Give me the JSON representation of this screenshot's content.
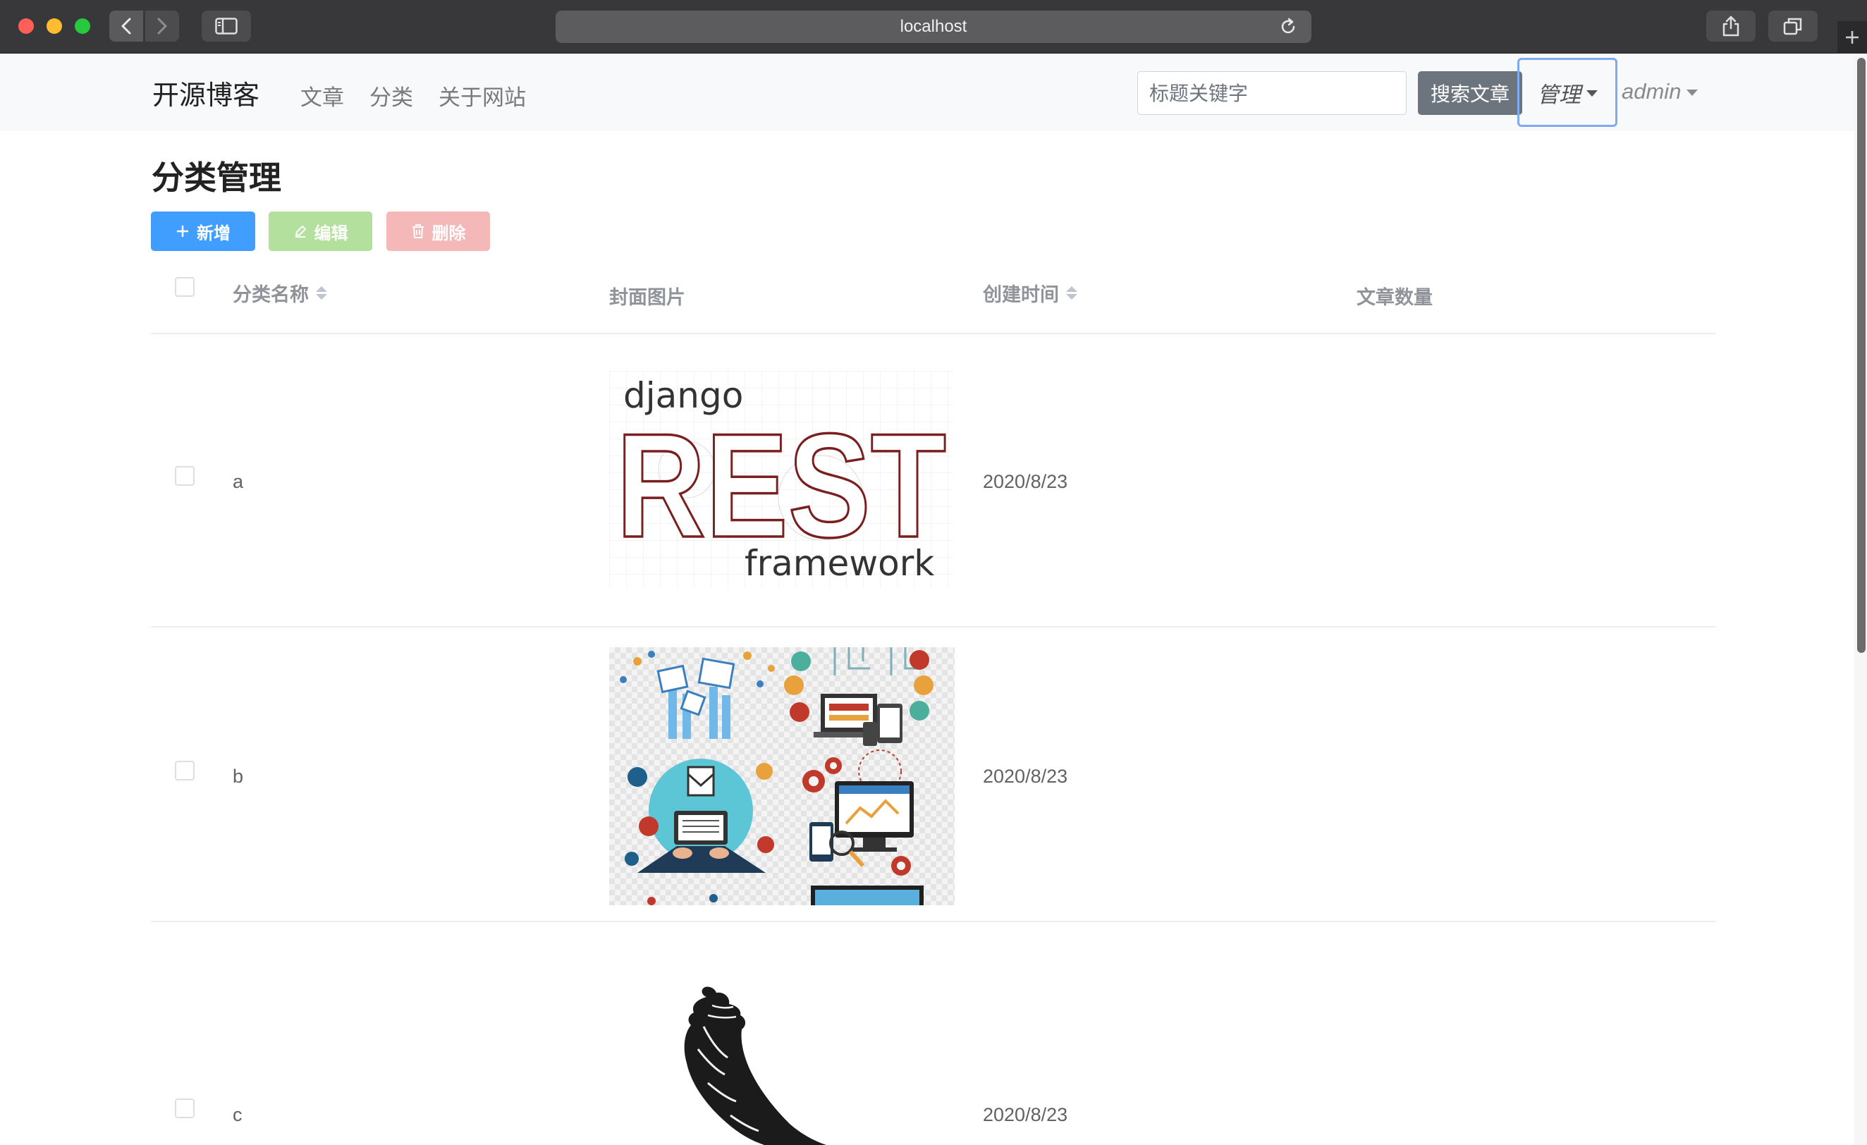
{
  "browser": {
    "url": "localhost"
  },
  "navbar": {
    "brand": "开源博客",
    "links": [
      "文章",
      "分类",
      "关于网站"
    ],
    "search_placeholder": "标题关键字",
    "search_button": "搜索文章",
    "manage_label": "管理",
    "user_label": "admin"
  },
  "page": {
    "title": "分类管理"
  },
  "toolbar": {
    "add_label": "新增",
    "edit_label": "编辑",
    "delete_label": "删除"
  },
  "table": {
    "headers": {
      "name": "分类名称",
      "cover": "封面图片",
      "created": "创建时间",
      "count": "文章数量"
    },
    "rows": [
      {
        "name": "a",
        "created": "2020/8/23",
        "count": "",
        "cover": {
          "top": "django",
          "main": "REST",
          "bottom": "framework"
        }
      },
      {
        "name": "b",
        "created": "2020/8/23",
        "count": ""
      },
      {
        "name": "c",
        "created": "2020/8/23",
        "count": ""
      }
    ]
  },
  "colors": {
    "primary": "#409eff",
    "success_light": "#b3e19d",
    "danger_light": "#f5b8b8",
    "rest_outline": "#7a1f1f"
  }
}
